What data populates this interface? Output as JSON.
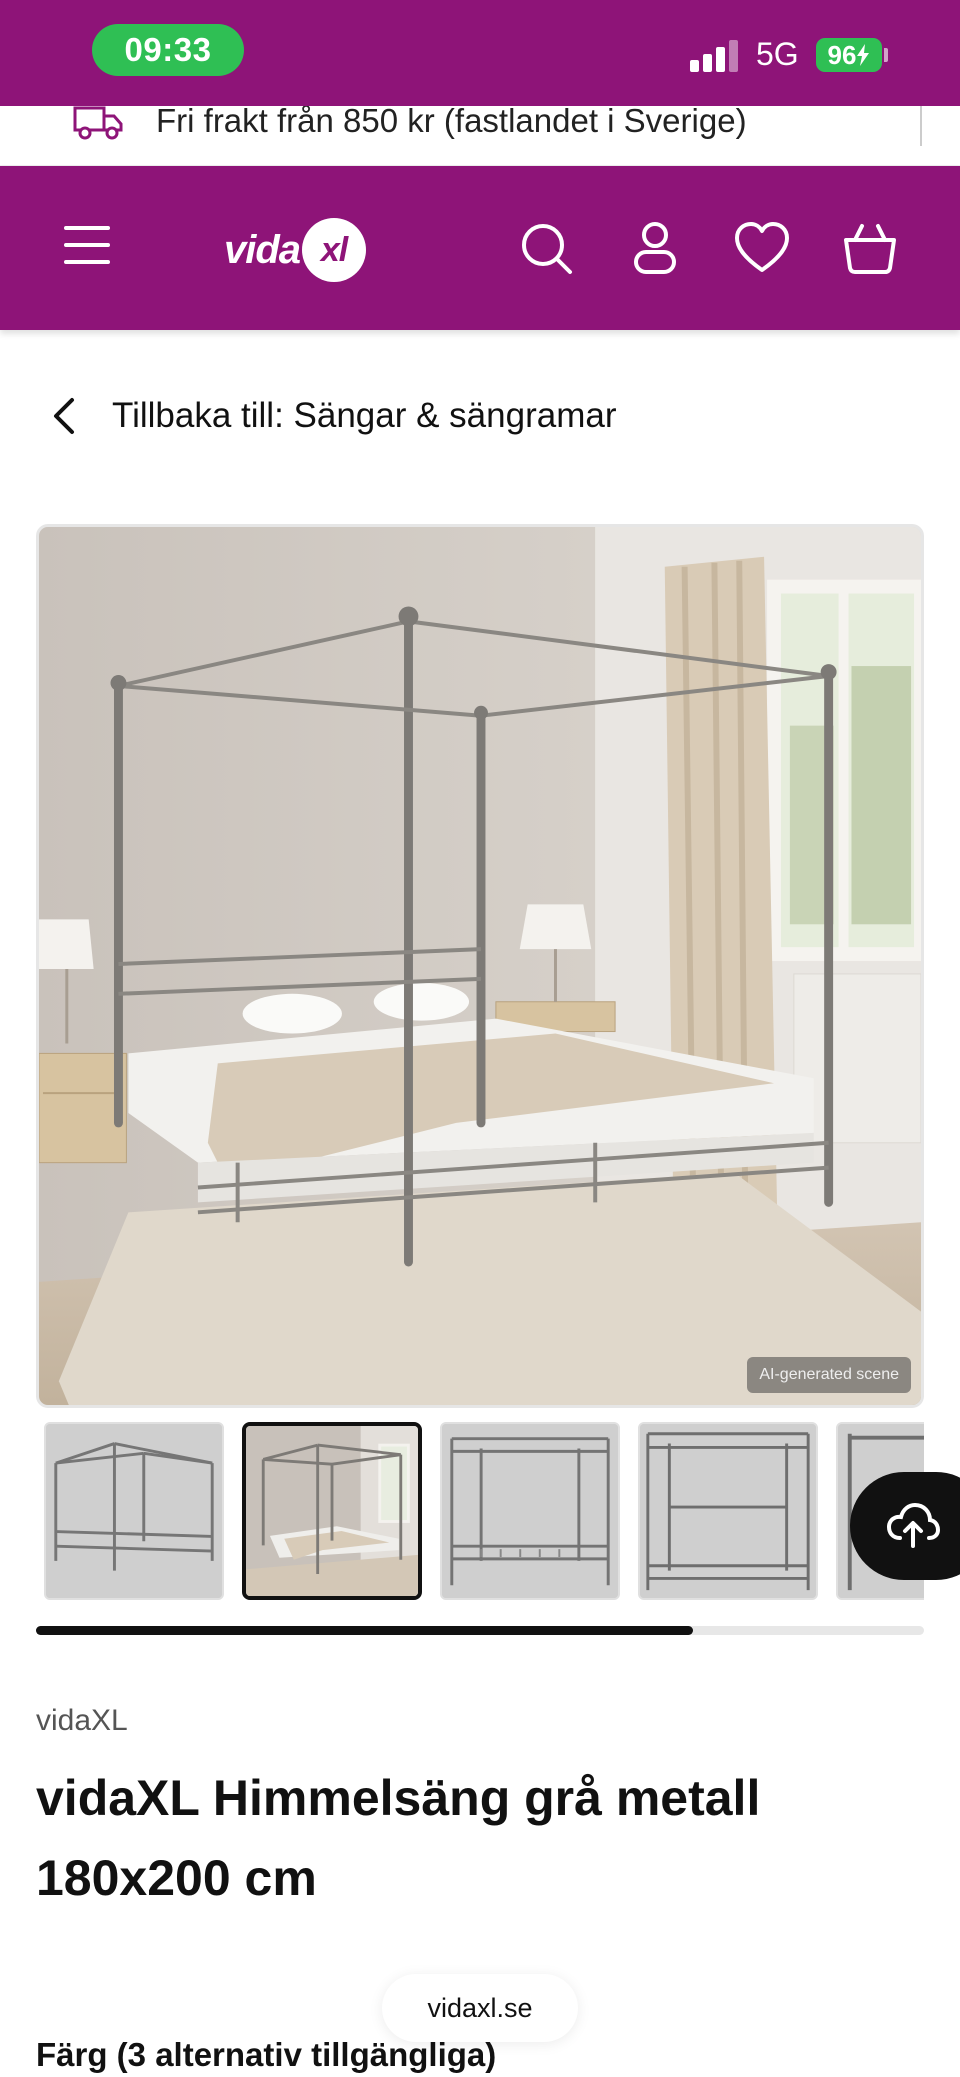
{
  "status_bar": {
    "time": "09:33",
    "network": "5G",
    "battery": "96"
  },
  "shipping_banner": {
    "text": "Fri frakt från 850 kr (fastlandet i Sverige)",
    "icon": "truck-icon"
  },
  "header": {
    "logo_text": "vida",
    "logo_badge": "xl",
    "icons": [
      "menu-icon",
      "search-icon",
      "account-icon",
      "heart-icon",
      "basket-icon"
    ],
    "brand_color": "#8e1478"
  },
  "back_link": {
    "label": "Tillbaka till: Sängar & sängramar"
  },
  "gallery": {
    "ai_tag": "AI-generated scene",
    "active_thumbnail_index": 1,
    "thumbnail_count_visible": 5,
    "scroll_progress": 0.74
  },
  "product": {
    "brand": "vidaXL",
    "title": "vidaXL Himmelsäng grå metall 180x200 cm",
    "color_heading": "Färg (3 alternativ tillgängliga)"
  },
  "browser": {
    "url": "vidaxl.se"
  }
}
